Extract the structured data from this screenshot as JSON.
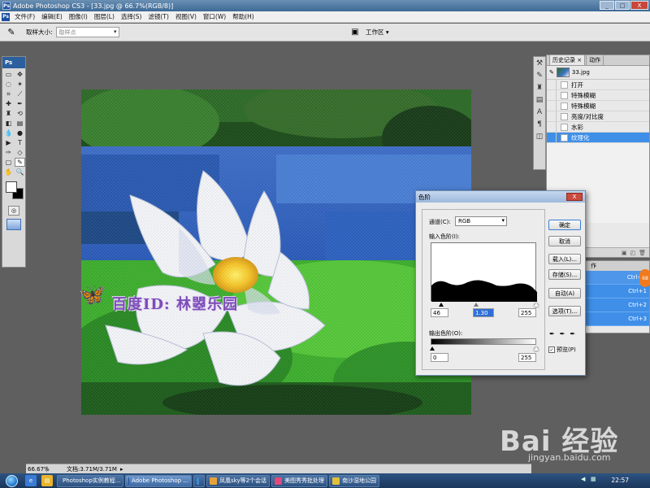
{
  "window": {
    "title": "Adobe Photoshop CS3 - [33.jpg @ 66.7%(RGB/8)]",
    "app_icon": "Ps",
    "controls": [
      "_",
      "□",
      "X"
    ]
  },
  "menu": [
    "文件(F)",
    "编辑(E)",
    "图像(I)",
    "图层(L)",
    "选择(S)",
    "滤镜(T)",
    "视图(V)",
    "窗口(W)",
    "帮助(H)"
  ],
  "options": {
    "sample_label": "取样大小:",
    "sample_value": "取样点",
    "workspace_label": "工作区 ▾"
  },
  "toolbox": {
    "header": "Ps"
  },
  "history": {
    "tabs": [
      "历史记录 ×",
      "动作"
    ],
    "snapshot": "33.jpg",
    "steps": [
      {
        "label": "打开",
        "selected": false
      },
      {
        "label": "特殊模糊",
        "selected": false
      },
      {
        "label": "特殊模糊",
        "selected": false
      },
      {
        "label": "亮度/对比度",
        "selected": false
      },
      {
        "label": "水彩",
        "selected": false
      },
      {
        "label": "纹理化",
        "selected": true
      }
    ]
  },
  "actions": {
    "tab": "作",
    "shortcuts": [
      "Ctrl+=",
      "Ctrl+1",
      "Ctrl+2",
      "Ctrl+3"
    ]
  },
  "levels_dialog": {
    "title": "色阶",
    "close": "X",
    "channel_label": "通道(C):",
    "channel_value": "RGB",
    "input_label": "输入色阶(I):",
    "input_values": [
      "46",
      "1.30",
      "255"
    ],
    "output_label": "输出色阶(O):",
    "output_values": [
      "0",
      "255"
    ],
    "buttons": [
      "确定",
      "取消",
      "载入(L)...",
      "存储(S)...",
      "自动(A)",
      "选项(T)..."
    ],
    "preview_label": "预览(P)",
    "preview_checked": true
  },
  "canvas": {
    "watermark": "百度ID: 林曌乐园"
  },
  "status": {
    "zoom": "66.67%",
    "doc": "文档:3.71M/3.71M"
  },
  "taskbar": {
    "tasks": [
      {
        "label": "Photoshop实例教程...",
        "active": false,
        "color": "#55a44a"
      },
      {
        "label": "Adobe Photoshop ...",
        "active": true,
        "color": "#1c4fa0"
      },
      {
        "label": "",
        "active": false,
        "color": "#3a8ad8"
      },
      {
        "label": "凤凰sky等2个会话",
        "active": false,
        "color": "#e6a23a"
      },
      {
        "label": "美图秀秀批处理",
        "active": false,
        "color": "#e04a7a"
      },
      {
        "label": "南沙湿地公园",
        "active": false,
        "color": "#e0c03a"
      }
    ],
    "clock": "22:57"
  },
  "baidu_watermark": {
    "brand": "Bai 经验",
    "url": "jingyan.baidu.com"
  }
}
